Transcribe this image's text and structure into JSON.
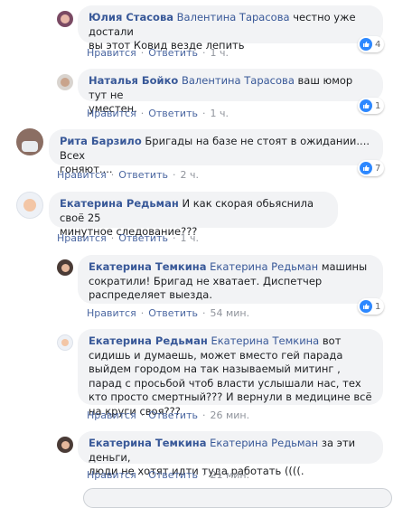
{
  "comments": [
    {
      "author": "Юлия Стасова",
      "mention": "Валентина Тарасова",
      "text_first": "честно уже достали",
      "text_rest": "вы этот Ковид везде лепить",
      "like": "Нравится",
      "reply": "Ответить",
      "time": "1 ч.",
      "likes": "4"
    },
    {
      "author": "Наталья Бойко",
      "mention": "Валентина Тарасова",
      "text_first": "ваш юмор тут не",
      "text_rest": "уместен.",
      "like": "Нравится",
      "reply": "Ответить",
      "time": "1 ч.",
      "likes": "1"
    },
    {
      "author": "Рита Барзило",
      "text_first": "Бригады на базе не стоят в ожидании.... Всех",
      "text_rest": "гоняют....",
      "like": "Нравится",
      "reply": "Ответить",
      "time": "2 ч.",
      "likes": "7"
    },
    {
      "author": "Екатерина Редьман",
      "text_first": "И как скорая обьяснила своё 25",
      "text_rest": "минутное следование???",
      "like": "Нравится",
      "reply": "Ответить",
      "time": "1 ч."
    },
    {
      "author": "Екатерина Темкина",
      "mention": "Екатерина Редьман",
      "text_first": "машины",
      "text_rest": "сократили! Бригад не хватает. Диспетчер распределяет выезда.",
      "like": "Нравится",
      "reply": "Ответить",
      "time": "54 мин.",
      "likes": "1"
    },
    {
      "author": "Екатерина Редьман",
      "mention": "Екатерина Темкина",
      "text_first": "вот сидишь и",
      "text_rest": "думаешь, может вместо гей парада выйдем городом на так называемый митинг , парад с просьбой чтоб власти услышали нас, тех кто просто смертный??? И вернули в медицине всё на круги своя???",
      "like": "Нравится",
      "reply": "Ответить",
      "time": "26 мин."
    },
    {
      "author": "Екатерина Темкина",
      "mention": "Екатерина Редьман",
      "text_first": "за эти деньги,",
      "text_rest": "люди не хотят идти туда работать ((((.",
      "like": "Нравится",
      "reply": "Ответить",
      "time": "21 мин."
    }
  ]
}
